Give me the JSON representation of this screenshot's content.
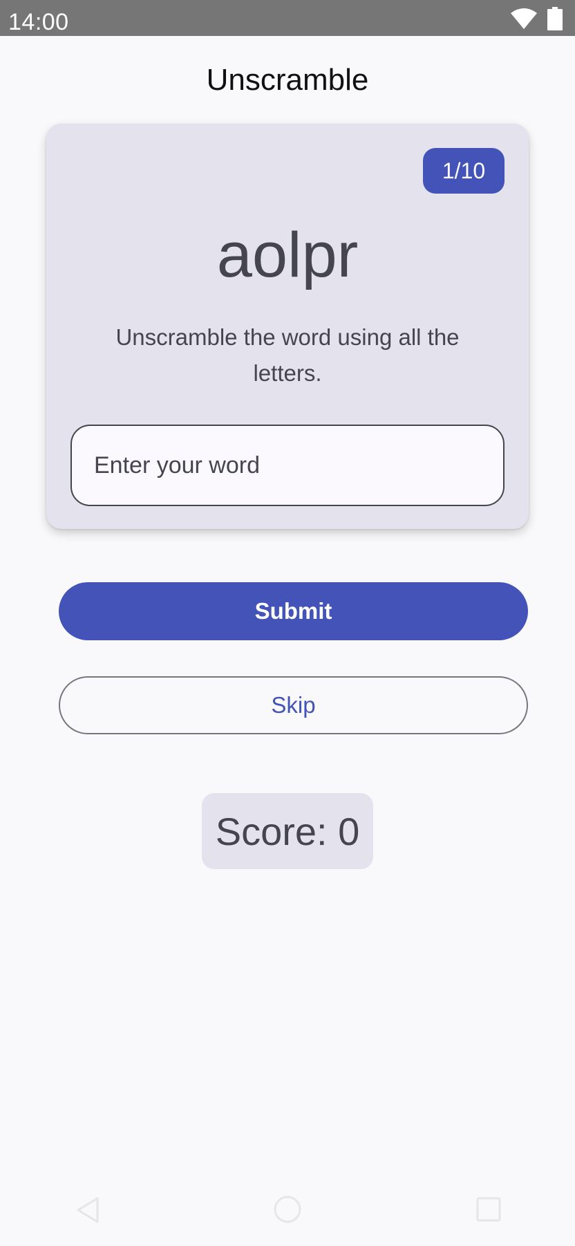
{
  "status_bar": {
    "time": "14:00",
    "icons": [
      "wifi-icon",
      "battery-icon"
    ]
  },
  "app": {
    "title": "Unscramble"
  },
  "game_card": {
    "word_count": "1/10",
    "scrambled_word": "aolpr",
    "instructions": "Unscramble the word using all the letters.",
    "input": {
      "placeholder": "Enter your word",
      "value": ""
    }
  },
  "actions": {
    "submit_label": "Submit",
    "skip_label": "Skip"
  },
  "score": {
    "text": "Score: 0"
  },
  "nav_bar": {
    "icons": [
      "back-icon",
      "home-icon",
      "recents-icon"
    ]
  },
  "colors": {
    "primary": "#4353b8",
    "card_background": "#e4e2ed",
    "page_background": "#f9f9fb",
    "status_bar": "#767676",
    "on_surface_variant": "#45454f"
  }
}
